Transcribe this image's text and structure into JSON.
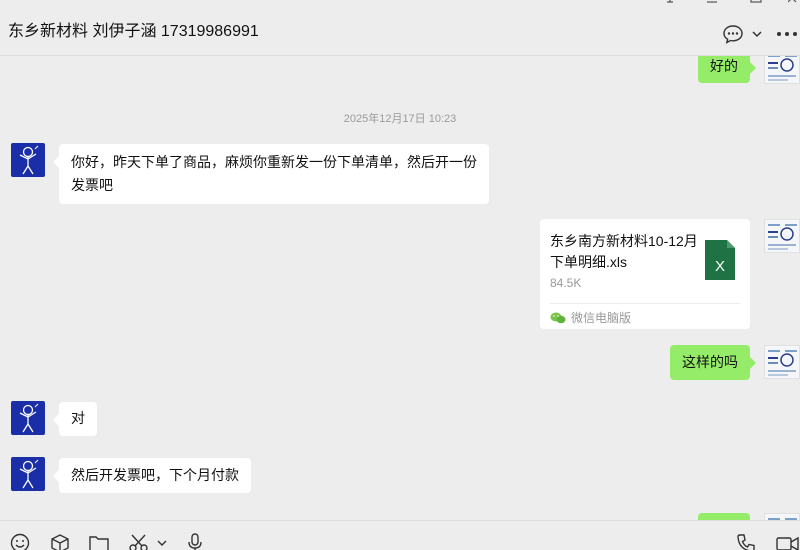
{
  "header": {
    "title": "东乡新材料 刘伊子涵 17319986991",
    "buttons": [
      "chat-options",
      "more"
    ]
  },
  "messages": {
    "m1": {
      "side": "right",
      "text": "好的"
    },
    "timestamp": "2025年12月17日 10:23",
    "m2": {
      "side": "left",
      "text": "你好，昨天下单了商品，麻烦你重新发一份下单清单，然后开一份发票吧"
    },
    "file": {
      "name": "东乡南方新材料10-12月下单明细.xls",
      "size": "84.5K",
      "source": "微信电脑版"
    },
    "m3": {
      "side": "right",
      "text": "这样的吗"
    },
    "m4": {
      "side": "left",
      "text": "对"
    },
    "m5": {
      "side": "left",
      "text": "然后开发票吧，下个月付款"
    }
  },
  "toolbar": {
    "icons": [
      "emoji-icon",
      "cube-icon",
      "folder-icon",
      "scissors-icon",
      "microphone-icon",
      "phone-icon",
      "video-icon"
    ]
  },
  "colors": {
    "bubble_right": "#95ec69",
    "bubble_left": "#ffffff",
    "background": "#ededed",
    "avatar": "#1a2ea8",
    "excel": "#1f7244"
  }
}
